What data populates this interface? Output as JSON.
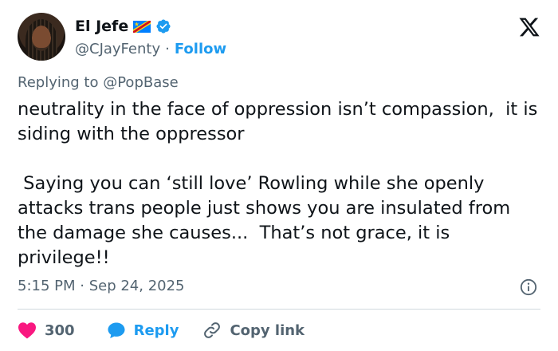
{
  "author": {
    "display_name": "El Jefe",
    "handle": "@CJayFenty",
    "separator": "·",
    "follow_label": "Follow",
    "flag_icon": "drc-flag-icon",
    "verified_icon": "verified-badge-icon"
  },
  "reply_context": {
    "prefix": "Replying to",
    "mention": "@PopBase"
  },
  "tweet": {
    "text": "neutrality in the face of oppression isn’t compassion,  it is siding with the oppressor\n\n Saying you can ‘still love’ Rowling while she openly attacks trans people just shows you are insulated from the damage she causes...  That’s not grace, it is privilege!!",
    "timestamp": "5:15 PM · Sep 24, 2025"
  },
  "actions": {
    "like_count": "300",
    "reply_label": "Reply",
    "copy_label": "Copy link"
  },
  "colors": {
    "accent": "#1d9bf0",
    "like": "#f91880",
    "muted": "#536471",
    "text": "#0f1419"
  }
}
